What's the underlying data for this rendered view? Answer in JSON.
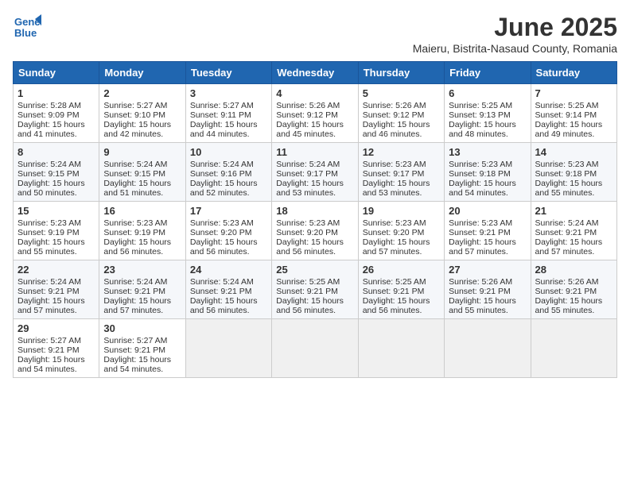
{
  "header": {
    "logo_line1": "General",
    "logo_line2": "Blue",
    "month": "June 2025",
    "location": "Maieru, Bistrita-Nasaud County, Romania"
  },
  "weekdays": [
    "Sunday",
    "Monday",
    "Tuesday",
    "Wednesday",
    "Thursday",
    "Friday",
    "Saturday"
  ],
  "weeks": [
    [
      {
        "day": "1",
        "lines": [
          "Sunrise: 5:28 AM",
          "Sunset: 9:09 PM",
          "Daylight: 15 hours",
          "and 41 minutes."
        ]
      },
      {
        "day": "2",
        "lines": [
          "Sunrise: 5:27 AM",
          "Sunset: 9:10 PM",
          "Daylight: 15 hours",
          "and 42 minutes."
        ]
      },
      {
        "day": "3",
        "lines": [
          "Sunrise: 5:27 AM",
          "Sunset: 9:11 PM",
          "Daylight: 15 hours",
          "and 44 minutes."
        ]
      },
      {
        "day": "4",
        "lines": [
          "Sunrise: 5:26 AM",
          "Sunset: 9:12 PM",
          "Daylight: 15 hours",
          "and 45 minutes."
        ]
      },
      {
        "day": "5",
        "lines": [
          "Sunrise: 5:26 AM",
          "Sunset: 9:12 PM",
          "Daylight: 15 hours",
          "and 46 minutes."
        ]
      },
      {
        "day": "6",
        "lines": [
          "Sunrise: 5:25 AM",
          "Sunset: 9:13 PM",
          "Daylight: 15 hours",
          "and 48 minutes."
        ]
      },
      {
        "day": "7",
        "lines": [
          "Sunrise: 5:25 AM",
          "Sunset: 9:14 PM",
          "Daylight: 15 hours",
          "and 49 minutes."
        ]
      }
    ],
    [
      {
        "day": "8",
        "lines": [
          "Sunrise: 5:24 AM",
          "Sunset: 9:15 PM",
          "Daylight: 15 hours",
          "and 50 minutes."
        ]
      },
      {
        "day": "9",
        "lines": [
          "Sunrise: 5:24 AM",
          "Sunset: 9:15 PM",
          "Daylight: 15 hours",
          "and 51 minutes."
        ]
      },
      {
        "day": "10",
        "lines": [
          "Sunrise: 5:24 AM",
          "Sunset: 9:16 PM",
          "Daylight: 15 hours",
          "and 52 minutes."
        ]
      },
      {
        "day": "11",
        "lines": [
          "Sunrise: 5:24 AM",
          "Sunset: 9:17 PM",
          "Daylight: 15 hours",
          "and 53 minutes."
        ]
      },
      {
        "day": "12",
        "lines": [
          "Sunrise: 5:23 AM",
          "Sunset: 9:17 PM",
          "Daylight: 15 hours",
          "and 53 minutes."
        ]
      },
      {
        "day": "13",
        "lines": [
          "Sunrise: 5:23 AM",
          "Sunset: 9:18 PM",
          "Daylight: 15 hours",
          "and 54 minutes."
        ]
      },
      {
        "day": "14",
        "lines": [
          "Sunrise: 5:23 AM",
          "Sunset: 9:18 PM",
          "Daylight: 15 hours",
          "and 55 minutes."
        ]
      }
    ],
    [
      {
        "day": "15",
        "lines": [
          "Sunrise: 5:23 AM",
          "Sunset: 9:19 PM",
          "Daylight: 15 hours",
          "and 55 minutes."
        ]
      },
      {
        "day": "16",
        "lines": [
          "Sunrise: 5:23 AM",
          "Sunset: 9:19 PM",
          "Daylight: 15 hours",
          "and 56 minutes."
        ]
      },
      {
        "day": "17",
        "lines": [
          "Sunrise: 5:23 AM",
          "Sunset: 9:20 PM",
          "Daylight: 15 hours",
          "and 56 minutes."
        ]
      },
      {
        "day": "18",
        "lines": [
          "Sunrise: 5:23 AM",
          "Sunset: 9:20 PM",
          "Daylight: 15 hours",
          "and 56 minutes."
        ]
      },
      {
        "day": "19",
        "lines": [
          "Sunrise: 5:23 AM",
          "Sunset: 9:20 PM",
          "Daylight: 15 hours",
          "and 57 minutes."
        ]
      },
      {
        "day": "20",
        "lines": [
          "Sunrise: 5:23 AM",
          "Sunset: 9:21 PM",
          "Daylight: 15 hours",
          "and 57 minutes."
        ]
      },
      {
        "day": "21",
        "lines": [
          "Sunrise: 5:24 AM",
          "Sunset: 9:21 PM",
          "Daylight: 15 hours",
          "and 57 minutes."
        ]
      }
    ],
    [
      {
        "day": "22",
        "lines": [
          "Sunrise: 5:24 AM",
          "Sunset: 9:21 PM",
          "Daylight: 15 hours",
          "and 57 minutes."
        ]
      },
      {
        "day": "23",
        "lines": [
          "Sunrise: 5:24 AM",
          "Sunset: 9:21 PM",
          "Daylight: 15 hours",
          "and 57 minutes."
        ]
      },
      {
        "day": "24",
        "lines": [
          "Sunrise: 5:24 AM",
          "Sunset: 9:21 PM",
          "Daylight: 15 hours",
          "and 56 minutes."
        ]
      },
      {
        "day": "25",
        "lines": [
          "Sunrise: 5:25 AM",
          "Sunset: 9:21 PM",
          "Daylight: 15 hours",
          "and 56 minutes."
        ]
      },
      {
        "day": "26",
        "lines": [
          "Sunrise: 5:25 AM",
          "Sunset: 9:21 PM",
          "Daylight: 15 hours",
          "and 56 minutes."
        ]
      },
      {
        "day": "27",
        "lines": [
          "Sunrise: 5:26 AM",
          "Sunset: 9:21 PM",
          "Daylight: 15 hours",
          "and 55 minutes."
        ]
      },
      {
        "day": "28",
        "lines": [
          "Sunrise: 5:26 AM",
          "Sunset: 9:21 PM",
          "Daylight: 15 hours",
          "and 55 minutes."
        ]
      }
    ],
    [
      {
        "day": "29",
        "lines": [
          "Sunrise: 5:27 AM",
          "Sunset: 9:21 PM",
          "Daylight: 15 hours",
          "and 54 minutes."
        ]
      },
      {
        "day": "30",
        "lines": [
          "Sunrise: 5:27 AM",
          "Sunset: 9:21 PM",
          "Daylight: 15 hours",
          "and 54 minutes."
        ]
      },
      {
        "day": "",
        "lines": []
      },
      {
        "day": "",
        "lines": []
      },
      {
        "day": "",
        "lines": []
      },
      {
        "day": "",
        "lines": []
      },
      {
        "day": "",
        "lines": []
      }
    ]
  ]
}
